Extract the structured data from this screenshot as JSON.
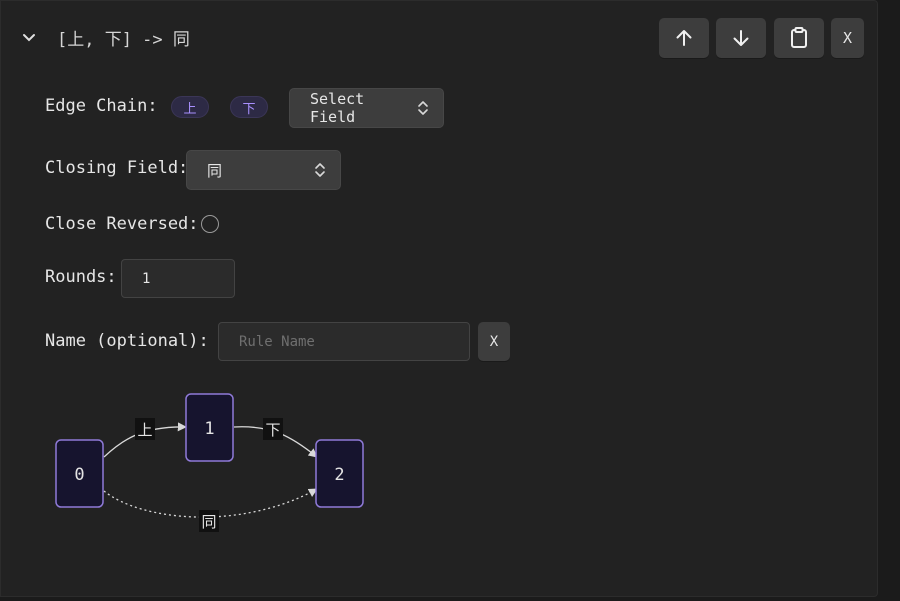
{
  "header": {
    "title": "[上, 下] -> 同",
    "icons": {
      "collapse": "chevron-down-icon",
      "up": "arrow-up-icon",
      "down": "arrow-down-icon",
      "copy": "clipboard-icon"
    },
    "delete_label": "X"
  },
  "edge_chain": {
    "label": "Edge Chain:",
    "fields": [
      "上",
      "下"
    ],
    "select_placeholder": "Select Field"
  },
  "closing_field": {
    "label": "Closing Field:",
    "value": "同"
  },
  "close_reversed": {
    "label": "Close Reversed:",
    "checked": false
  },
  "rounds": {
    "label": "Rounds:",
    "value": "1"
  },
  "name": {
    "label": "Name (optional):",
    "placeholder": "Rule Name",
    "clear_label": "X"
  },
  "diagram": {
    "nodes": [
      "0",
      "1",
      "2"
    ],
    "edges": [
      {
        "from": "0",
        "to": "1",
        "label": "上"
      },
      {
        "from": "1",
        "to": "2",
        "label": "下"
      },
      {
        "from": "0",
        "to": "2",
        "label": "同",
        "style": "dotted"
      }
    ],
    "colors": {
      "node_fill": "#16142e",
      "node_border": "#8f7ad8",
      "edge": "#d9d9d9"
    }
  }
}
